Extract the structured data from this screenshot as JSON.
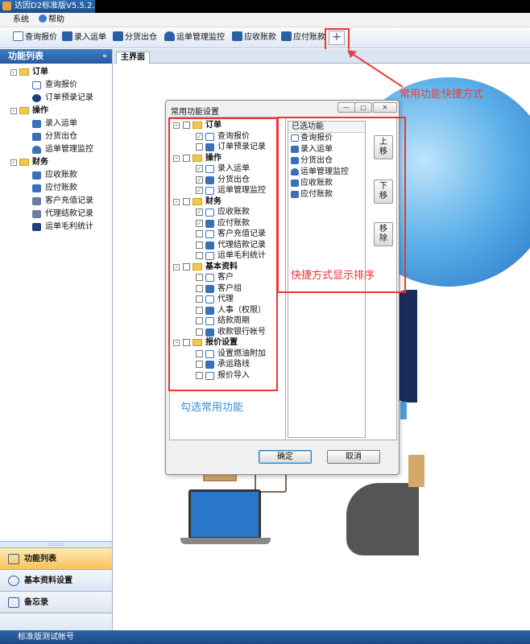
{
  "window": {
    "title": "达因D2标准版V5.5.2.2"
  },
  "menu": {
    "system": "系统",
    "help": "帮助"
  },
  "toolbar": {
    "items": [
      "查询报价",
      "录入运单",
      "分货出仓",
      "运单管理监控",
      "应收账款",
      "应付账款"
    ],
    "add_symbol": "+"
  },
  "sidebar": {
    "title": "功能列表",
    "collapse_symbol": "«",
    "groups": [
      {
        "label": "订单",
        "items": [
          "查询报价",
          "订单预录记录"
        ]
      },
      {
        "label": "操作",
        "items": [
          "录入运单",
          "分货出仓",
          "运单管理监控"
        ]
      },
      {
        "label": "财务",
        "items": [
          "应收账款",
          "应付账款",
          "客户充值记录",
          "代理结款记录",
          "运单毛利统计"
        ]
      }
    ],
    "bottom_grip": "::::::::::",
    "bottom": [
      "功能列表",
      "基本资料设置",
      "备忘录"
    ]
  },
  "tabs": {
    "main": "主界面"
  },
  "dialog": {
    "title": "常用功能设置",
    "win_min": "—",
    "win_max": "□",
    "win_close": "✕",
    "check_mark": "✓",
    "tree": [
      {
        "label": "订单",
        "items": [
          {
            "label": "查询报价",
            "checked": true
          },
          {
            "label": "订单预录记录",
            "checked": false
          }
        ]
      },
      {
        "label": "操作",
        "items": [
          {
            "label": "录入运单",
            "checked": true
          },
          {
            "label": "分货出仓",
            "checked": true
          },
          {
            "label": "运单管理监控",
            "checked": true
          }
        ]
      },
      {
        "label": "财务",
        "items": [
          {
            "label": "应收账款",
            "checked": true
          },
          {
            "label": "应付账款",
            "checked": true
          },
          {
            "label": "客户充值记录",
            "checked": false
          },
          {
            "label": "代理结款记录",
            "checked": false
          },
          {
            "label": "运单毛利统计",
            "checked": false
          }
        ]
      },
      {
        "label": "基本资料",
        "items": [
          {
            "label": "客户",
            "checked": false
          },
          {
            "label": "客户组",
            "checked": false
          },
          {
            "label": "代理",
            "checked": false
          },
          {
            "label": "人事（权限）",
            "checked": false
          },
          {
            "label": "结款周期",
            "checked": false
          },
          {
            "label": "收款银行帐号",
            "checked": false
          }
        ]
      },
      {
        "label": "报价设置",
        "items": [
          {
            "label": "设置燃油附加",
            "checked": false
          },
          {
            "label": "承运路线",
            "checked": false
          },
          {
            "label": "报价导入",
            "checked": false
          }
        ]
      }
    ],
    "selected_header": "已选功能",
    "selected": [
      "查询报价",
      "录入运单",
      "分货出仓",
      "运单管理监控",
      "应收账款",
      "应付账款"
    ],
    "btn_up": [
      "上",
      "移"
    ],
    "btn_down": [
      "下",
      "移"
    ],
    "btn_remove": [
      "移",
      "除"
    ],
    "ok": "确定",
    "cancel": "取消"
  },
  "annotations": {
    "shortcut": "常用功能快捷方式",
    "check_common": "勾选常用功能",
    "order_display": "快捷方式显示排序"
  },
  "status": {
    "account": "标准版测试帐号"
  }
}
